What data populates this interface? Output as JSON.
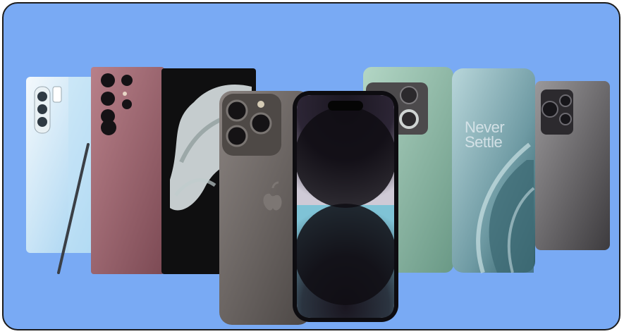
{
  "image": {
    "subject": "smartphones",
    "background_color": "#79aaf4",
    "frame_color": "#1c1c1c"
  },
  "phones": [
    {
      "name": "phone-white-with-stylus",
      "colors": [
        "#e8f3fa",
        "#9fd0f0"
      ]
    },
    {
      "name": "phone-burgundy-quad-camera",
      "colors": [
        "#a8707a",
        "#7c4a54"
      ]
    },
    {
      "name": "phone-black-screen-splash",
      "colors": [
        "#121212",
        "#e9efef"
      ]
    },
    {
      "name": "phone-space-black-back",
      "colors": [
        "#6a6462",
        "#3a3635"
      ]
    },
    {
      "name": "phone-dynamic-island-front",
      "colors": [
        "#15121a",
        "#c9c6cf"
      ]
    },
    {
      "name": "phone-green-back",
      "colors": [
        "#9fc7b4",
        "#5f8f79"
      ]
    },
    {
      "name": "phone-teal-curved-screen",
      "colors": [
        "#8fb6bd",
        "#43717a"
      ]
    },
    {
      "name": "phone-graphite-back",
      "colors": [
        "#7c7a7c",
        "#3d3b3e"
      ]
    }
  ],
  "screen_text": {
    "line1": "Never",
    "line2": "Settle"
  }
}
